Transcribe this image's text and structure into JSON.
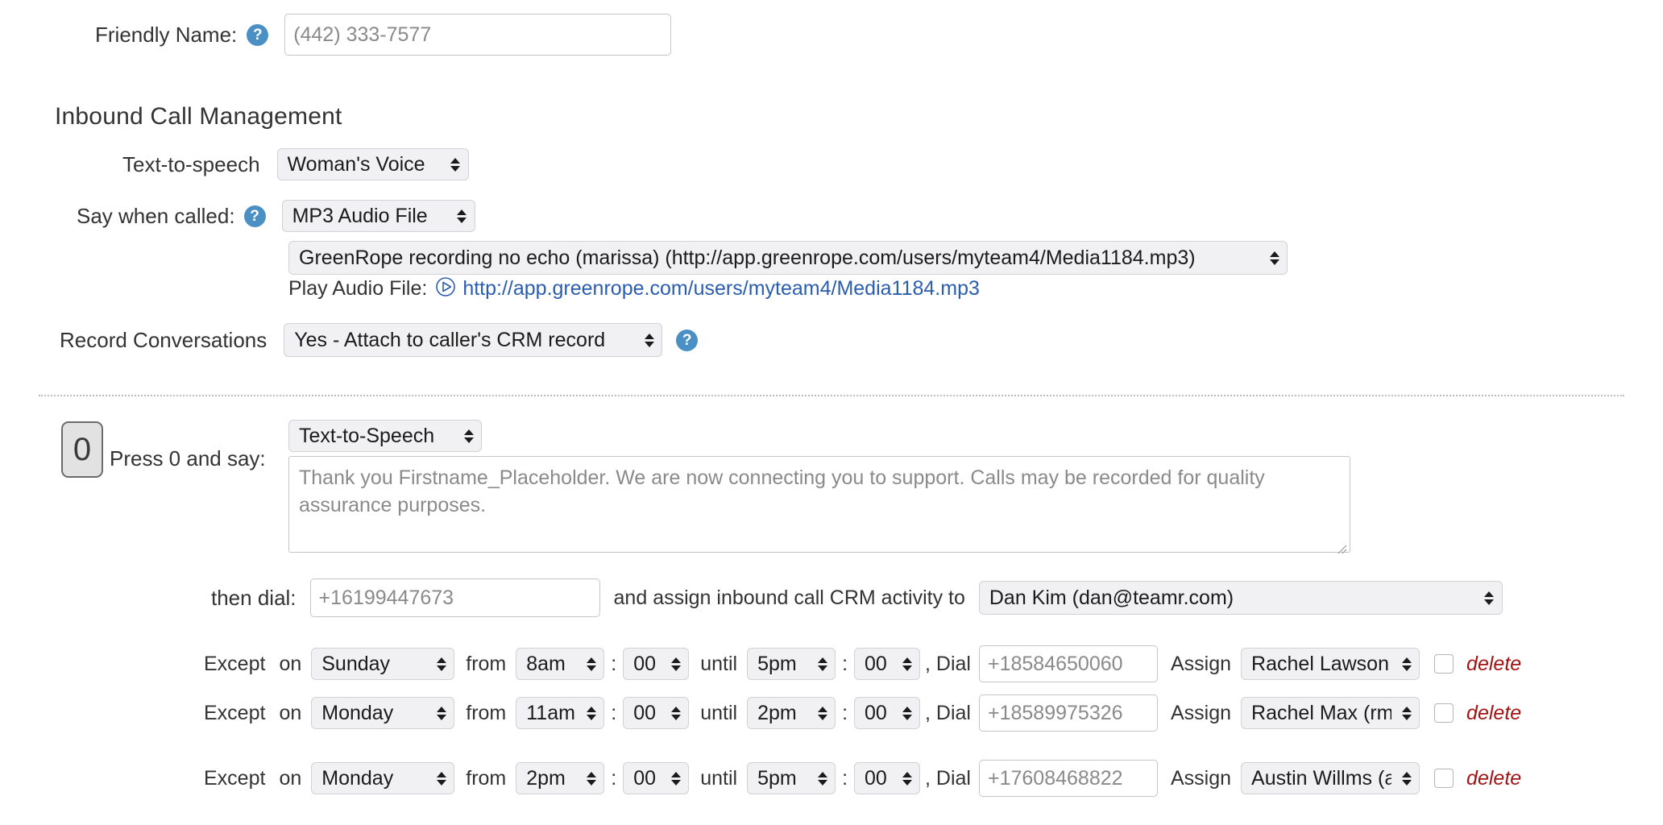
{
  "friendly_name": {
    "label": "Friendly Name:",
    "help_icon": "question-help-icon",
    "value": "",
    "placeholder": "(442) 333-7577"
  },
  "inbound": {
    "heading": "Inbound Call Management",
    "tts": {
      "label": "Text-to-speech",
      "value": "Woman's Voice"
    },
    "say_when_called": {
      "label": "Say when called:",
      "type_value": "MP3 Audio File",
      "file_value": "GreenRope recording no echo (marissa) (http://app.greenrope.com/users/myteam4/Media1184.mp3)",
      "play_label": "Play Audio File:",
      "play_icon": "play-circle-icon",
      "play_url": "http://app.greenrope.com/users/myteam4/Media1184.mp3"
    },
    "record": {
      "label": "Record Conversations",
      "value": "Yes - Attach to caller's CRM record",
      "help_icon": "question-help-icon"
    }
  },
  "press_block": {
    "key": "0",
    "label": "Press 0 and say:",
    "action_type": "Text-to-Speech",
    "message_value": "",
    "message_placeholder": "Thank you Firstname_Placeholder. We are now connecting you to support. Calls may be recorded for quality assurance purposes.",
    "then_dial_label": "then dial:",
    "then_dial_value": "",
    "then_dial_placeholder": "+16199447673",
    "assign_text": "and assign inbound call CRM activity to",
    "assign_value": "Dan Kim (dan@teamr.com)"
  },
  "exception_labels": {
    "except": "Except",
    "on": "on",
    "from": "from",
    "until": "until",
    "dial": ", Dial",
    "assign": "Assign",
    "delete": "delete",
    "colon": ":"
  },
  "exceptions": [
    {
      "day": "Sunday",
      "from_hour": "8am",
      "from_min": "00",
      "until_hour": "5pm",
      "until_min": "00",
      "dial_value": "",
      "dial_placeholder": "+18584650060",
      "assign": "Rachel Lawson (rach",
      "checked": false
    },
    {
      "day": "Monday",
      "from_hour": "11am",
      "from_min": "00",
      "until_hour": "2pm",
      "until_min": "00",
      "dial_value": "",
      "dial_placeholder": "+18589975326",
      "assign": "Rachel Max (rmax@g",
      "checked": false
    },
    {
      "day": "Monday",
      "from_hour": "2pm",
      "from_min": "00",
      "until_hour": "5pm",
      "until_min": "00",
      "dial_value": "",
      "dial_placeholder": "+17608468822",
      "assign": "Austin Willms (austir",
      "checked": false
    }
  ],
  "colors": {
    "help_blue": "#4a90c4",
    "link_blue": "#2a5db0",
    "delete_red": "#a31515"
  }
}
